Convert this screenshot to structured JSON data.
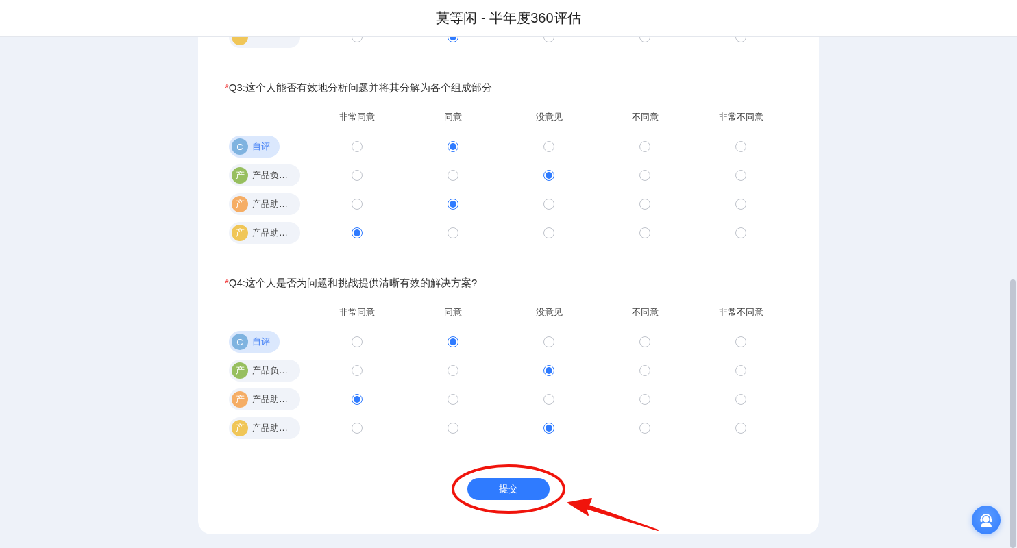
{
  "header": {
    "title": "莫等闲 - 半年度360评估"
  },
  "previous_rows": [
    {
      "color": "#f0c658",
      "choices": [
        {
          "selected": false
        },
        {
          "selected": true
        },
        {
          "selected": false
        },
        {
          "selected": false
        },
        {
          "selected": false
        }
      ]
    }
  ],
  "questions": [
    {
      "required_mark": "*",
      "title": "Q3:这个人能否有效地分析问题并将其分解为各个组成部分",
      "options": [
        "非常同意",
        "同意",
        "没意见",
        "不同意",
        "非常不同意"
      ],
      "rows": [
        {
          "kind": "self",
          "avatar": "C",
          "label": "自评",
          "color": "#7fb3e0",
          "choices": [
            {
              "selected": false
            },
            {
              "selected": true
            },
            {
              "selected": false
            },
            {
              "selected": false
            },
            {
              "selected": false
            }
          ]
        },
        {
          "kind": "other",
          "avatar": "产",
          "label": "产品负…",
          "color": "#97bf5f",
          "choices": [
            {
              "selected": false
            },
            {
              "selected": false
            },
            {
              "selected": true
            },
            {
              "selected": false
            },
            {
              "selected": false
            }
          ]
        },
        {
          "kind": "other",
          "avatar": "产",
          "label": "产品助…",
          "color": "#f5ad65",
          "choices": [
            {
              "selected": false
            },
            {
              "selected": true
            },
            {
              "selected": false
            },
            {
              "selected": false
            },
            {
              "selected": false
            }
          ]
        },
        {
          "kind": "other",
          "avatar": "产",
          "label": "产品助…",
          "color": "#f0c658",
          "choices": [
            {
              "selected": true
            },
            {
              "selected": false
            },
            {
              "selected": false
            },
            {
              "selected": false
            },
            {
              "selected": false
            }
          ]
        }
      ]
    },
    {
      "required_mark": "*",
      "title": "Q4:这个人是否为问题和挑战提供清晰有效的解决方案?",
      "options": [
        "非常同意",
        "同意",
        "没意见",
        "不同意",
        "非常不同意"
      ],
      "rows": [
        {
          "kind": "self",
          "avatar": "C",
          "label": "自评",
          "color": "#7fb3e0",
          "choices": [
            {
              "selected": false
            },
            {
              "selected": true
            },
            {
              "selected": false
            },
            {
              "selected": false
            },
            {
              "selected": false
            }
          ]
        },
        {
          "kind": "other",
          "avatar": "产",
          "label": "产品负…",
          "color": "#97bf5f",
          "choices": [
            {
              "selected": false
            },
            {
              "selected": false
            },
            {
              "selected": true
            },
            {
              "selected": false
            },
            {
              "selected": false
            }
          ]
        },
        {
          "kind": "other",
          "avatar": "产",
          "label": "产品助…",
          "color": "#f5ad65",
          "choices": [
            {
              "selected": true
            },
            {
              "selected": false
            },
            {
              "selected": false
            },
            {
              "selected": false
            },
            {
              "selected": false
            }
          ]
        },
        {
          "kind": "other",
          "avatar": "产",
          "label": "产品助…",
          "color": "#f0c658",
          "choices": [
            {
              "selected": false
            },
            {
              "selected": false
            },
            {
              "selected": true
            },
            {
              "selected": false
            },
            {
              "selected": false
            }
          ]
        }
      ]
    }
  ],
  "submit_button": {
    "label": "提交"
  }
}
